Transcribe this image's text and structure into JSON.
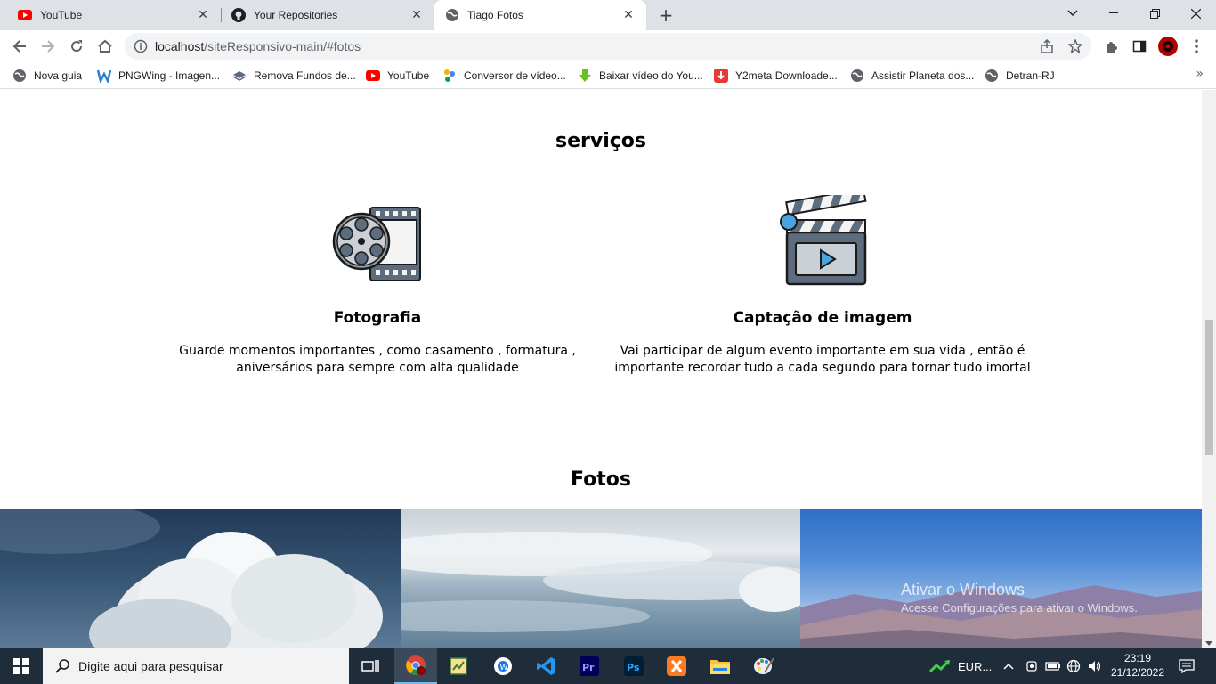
{
  "browser": {
    "tabs": [
      {
        "title": "YouTube",
        "icon": "youtube-icon",
        "active": false
      },
      {
        "title": "Your Repositories",
        "icon": "github-icon",
        "active": false
      },
      {
        "title": "Tiago Fotos",
        "icon": "globe-icon",
        "active": true
      }
    ],
    "new_tab_label": "+",
    "url_host": "localhost",
    "url_path": "/siteResponsivo-main/#fotos"
  },
  "bookmarks": [
    {
      "label": "Nova guia",
      "icon": "globe-icon"
    },
    {
      "label": "PNGWing - Imagen...",
      "icon": "pngwing-icon"
    },
    {
      "label": "Remova Fundos de...",
      "icon": "layers-icon"
    },
    {
      "label": "YouTube",
      "icon": "youtube-icon"
    },
    {
      "label": "Conversor de vídeo...",
      "icon": "dots-icon"
    },
    {
      "label": "Baixar vídeo do You...",
      "icon": "download-arrow-icon"
    },
    {
      "label": "Y2meta Downloade...",
      "icon": "y2meta-icon"
    },
    {
      "label": "Assistir Planeta dos...",
      "icon": "globe-icon"
    },
    {
      "label": "Detran-RJ",
      "icon": "globe-icon"
    }
  ],
  "page": {
    "services_title": "serviços",
    "services": [
      {
        "title": "Fotografia",
        "description": "Guarde momentos importantes , como casamento , formatura , aniversários para sempre com alta qualidade",
        "icon": "film-reel-icon"
      },
      {
        "title": "Captação de imagem",
        "description": "Vai participar de algum evento importante em sua vida , então é importante recordar tudo a cada segundo para tornar tudo imortal",
        "icon": "clapperboard-icon"
      }
    ],
    "photos_title": "Fotos",
    "photos": [
      "clouds-photo",
      "sky-photo",
      "mountains-photo"
    ]
  },
  "watermark": {
    "line1": "Ativar o Windows",
    "line2": "Acesse Configurações para ativar o Windows."
  },
  "taskbar": {
    "search_placeholder": "Digite aqui para pesquisar",
    "tray_app": "EUR...",
    "time": "23:19",
    "date": "21/12/2022"
  },
  "colors": {
    "tabstrip": "#dee1e6",
    "taskbar": "#1f2d3a",
    "accent_blue": "#4aa3df"
  }
}
